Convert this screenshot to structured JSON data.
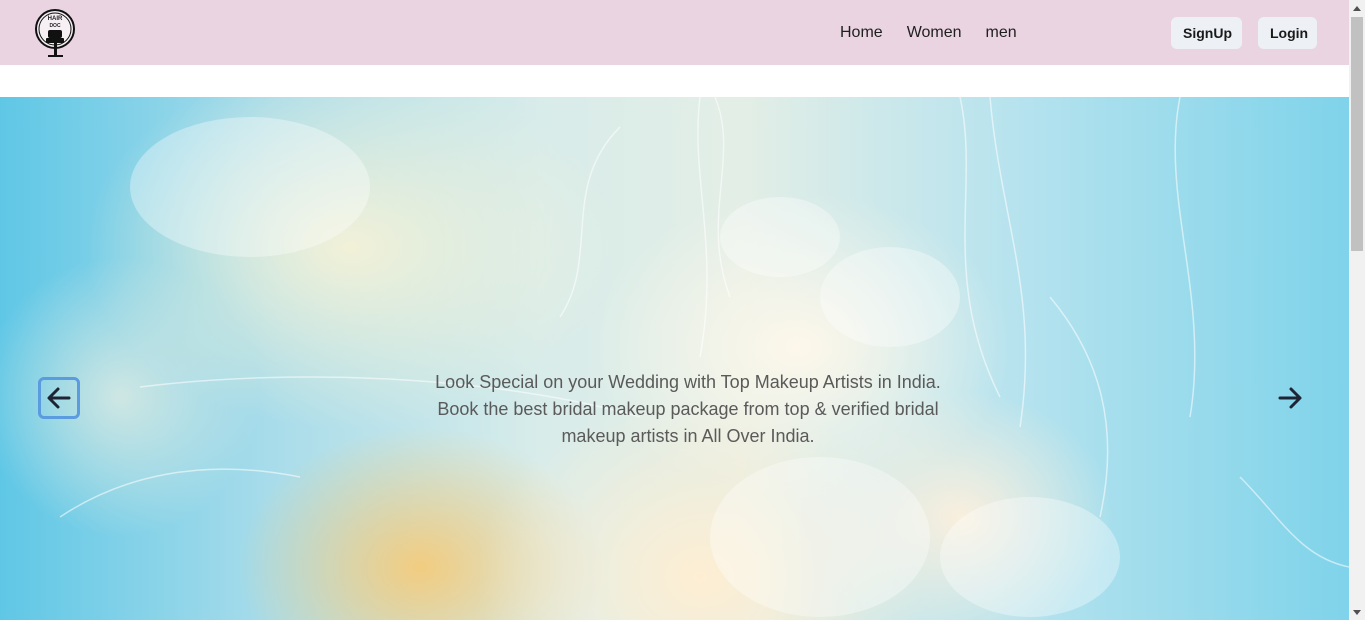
{
  "logo": {
    "text_line1": "HAIR",
    "text_line2": "DOC"
  },
  "nav": {
    "links": [
      "Home",
      "Women",
      "men"
    ],
    "signup_label": "SignUp",
    "login_label": "Login",
    "background": "#ead4e2"
  },
  "hero": {
    "caption": "Look Special on your Wedding with Top Makeup Artists in India. Book the best bridal makeup package from top & verified bridal makeup artists in All Over India.",
    "prev_icon": "arrow-left-icon",
    "next_icon": "arrow-right-icon"
  },
  "colors": {
    "accent_focus": "#5b9be0",
    "sky": "#5fc7e6"
  }
}
